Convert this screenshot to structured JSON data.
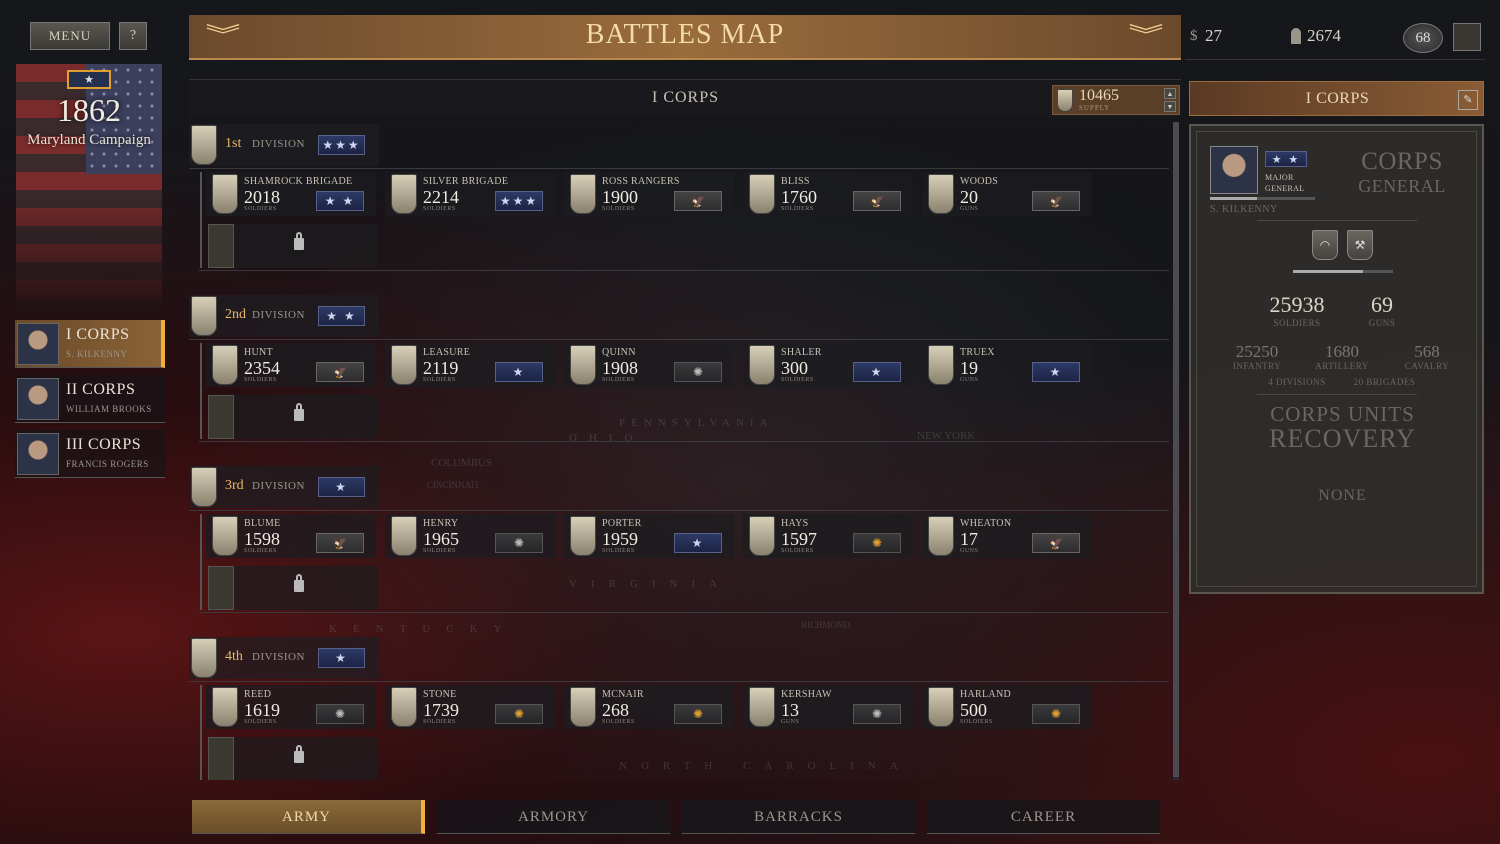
{
  "menu": {
    "menu_label": "MENU",
    "help_label": "?"
  },
  "campaign": {
    "badge_star": "★",
    "year": "1862",
    "name": "Maryland Campaign"
  },
  "corps_list": [
    {
      "name": "I CORPS",
      "commander": "S. KILKENNY",
      "active": true
    },
    {
      "name": "II CORPS",
      "commander": "WILLIAM BROOKS",
      "active": false
    },
    {
      "name": "III CORPS",
      "commander": "FRANCIS ROGERS",
      "active": false
    }
  ],
  "header": {
    "title": "BATTLES MAP",
    "chevron": "︾"
  },
  "resources": {
    "money_symbol": "$",
    "money": "27",
    "recruits": "2674",
    "rank": "68"
  },
  "corps_bar": {
    "title": "I CORPS",
    "supply_value": "10465",
    "supply_label": "SUPPLY",
    "up": "▲",
    "down": "▼"
  },
  "map_labels": [
    "PENNSYLVANIA",
    "NEW YORK",
    "COLUMBUS",
    "CINCINNATI",
    "VIRGINIA",
    "KENTUCKY",
    "RICHMOND",
    "NORTH CAROLINA",
    "OHIO"
  ],
  "division_label": "DIVISION",
  "divisions": [
    {
      "num": "1st",
      "stars": "★★★",
      "brigades": [
        {
          "name": "SHAMROCK BRIGADE",
          "value": "2018",
          "unit": "SOLDIERS",
          "badge": "stars",
          "badge_text": "★ ★"
        },
        {
          "name": "SILVER BRIGADE",
          "value": "2214",
          "unit": "SOLDIERS",
          "badge": "stars",
          "badge_text": "★★★"
        },
        {
          "name": "ROSS RANGERS",
          "value": "1900",
          "unit": "SOLDIERS",
          "badge": "eagle",
          "badge_text": "🦅"
        },
        {
          "name": "BLISS",
          "value": "1760",
          "unit": "SOLDIERS",
          "badge": "eagle",
          "badge_text": "🦅"
        },
        {
          "name": "WOODS",
          "value": "20",
          "unit": "GUNS",
          "badge": "eagle",
          "badge_text": "🦅"
        }
      ]
    },
    {
      "num": "2nd",
      "stars": "★ ★",
      "brigades": [
        {
          "name": "HUNT",
          "value": "2354",
          "unit": "SOLDIERS",
          "badge": "eagle",
          "badge_text": "🦅"
        },
        {
          "name": "LEASURE",
          "value": "2119",
          "unit": "SOLDIERS",
          "badge": "stars",
          "badge_text": "★"
        },
        {
          "name": "QUINN",
          "value": "1908",
          "unit": "SOLDIERS",
          "badge": "medal",
          "badge_text": "✺"
        },
        {
          "name": "SHALER",
          "value": "300",
          "unit": "SOLDIERS",
          "badge": "stars",
          "badge_text": "★"
        },
        {
          "name": "TRUEX",
          "value": "19",
          "unit": "GUNS",
          "badge": "stars",
          "badge_text": "★"
        }
      ]
    },
    {
      "num": "3rd",
      "stars": "★",
      "brigades": [
        {
          "name": "BLUME",
          "value": "1598",
          "unit": "SOLDIERS",
          "badge": "eagle",
          "badge_text": "🦅"
        },
        {
          "name": "HENRY",
          "value": "1965",
          "unit": "SOLDIERS",
          "badge": "medal",
          "badge_text": "✺"
        },
        {
          "name": "PORTER",
          "value": "1959",
          "unit": "SOLDIERS",
          "badge": "stars",
          "badge_text": "★"
        },
        {
          "name": "HAYS",
          "value": "1597",
          "unit": "SOLDIERS",
          "badge": "gold",
          "badge_text": "✺"
        },
        {
          "name": "WHEATON",
          "value": "17",
          "unit": "GUNS",
          "badge": "eagle",
          "badge_text": "🦅"
        }
      ]
    },
    {
      "num": "4th",
      "stars": "★",
      "brigades": [
        {
          "name": "REED",
          "value": "1619",
          "unit": "SOLDIERS",
          "badge": "medal",
          "badge_text": "✺"
        },
        {
          "name": "STONE",
          "value": "1739",
          "unit": "SOLDIERS",
          "badge": "gold",
          "badge_text": "✺"
        },
        {
          "name": "MCNAIR",
          "value": "268",
          "unit": "SOLDIERS",
          "badge": "gold",
          "badge_text": "✺"
        },
        {
          "name": "KERSHAW",
          "value": "13",
          "unit": "GUNS",
          "badge": "medal",
          "badge_text": "✺"
        },
        {
          "name": "HARLAND",
          "value": "500",
          "unit": "SOLDIERS",
          "badge": "gold",
          "badge_text": "✺"
        }
      ]
    }
  ],
  "tabs": [
    {
      "label": "ARMY",
      "active": true
    },
    {
      "label": "ARMORY",
      "active": false
    },
    {
      "label": "BARRACKS",
      "active": false
    },
    {
      "label": "CAREER",
      "active": false
    }
  ],
  "right_panel": {
    "title": "I CORPS",
    "edit_icon": "✎",
    "general_stars": "★ ★",
    "rank_line1": "MAJOR",
    "rank_line2": "GENERAL",
    "role_line1": "CORPS",
    "role_line2": "GENERAL",
    "general_name": "S. KILKENNY",
    "soldiers": "25938",
    "soldiers_label": "SOLDIERS",
    "guns": "69",
    "guns_label": "GUNS",
    "infantry": "25250",
    "infantry_label": "INFANTRY",
    "artillery": "1680",
    "artillery_label": "ARTILLERY",
    "cavalry": "568",
    "cavalry_label": "CAVALRY",
    "divisions_text": "4 DIVISIONS",
    "brigades_text": "20 BRIGADES",
    "recovery_line1": "CORPS UNITS",
    "recovery_line2": "RECOVERY",
    "recovery_value": "NONE"
  }
}
